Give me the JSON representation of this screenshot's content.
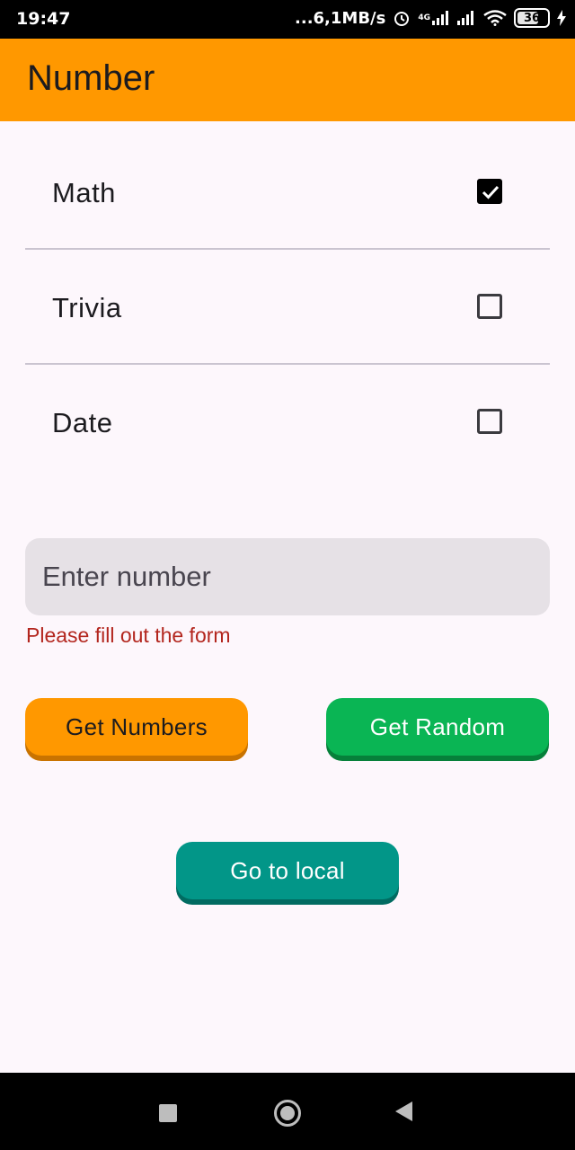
{
  "status_bar": {
    "time": "19:47",
    "speed": "...6,1MB/s",
    "network_label": "4G",
    "battery": "36"
  },
  "app_bar": {
    "title": "Number"
  },
  "checkboxes": [
    {
      "label": "Math",
      "checked": true
    },
    {
      "label": "Trivia",
      "checked": false
    },
    {
      "label": "Date",
      "checked": false
    }
  ],
  "number_input": {
    "placeholder": "Enter number",
    "value": ""
  },
  "error": "Please fill out the form",
  "buttons": {
    "get_numbers": "Get Numbers",
    "get_random": "Get Random",
    "go_to_local": "Go to local"
  },
  "colors": {
    "app_bar": "#ff9800",
    "get_numbers": "#ff9800",
    "get_random": "#0ab554",
    "go_to_local": "#029688",
    "error": "#b3261e"
  }
}
